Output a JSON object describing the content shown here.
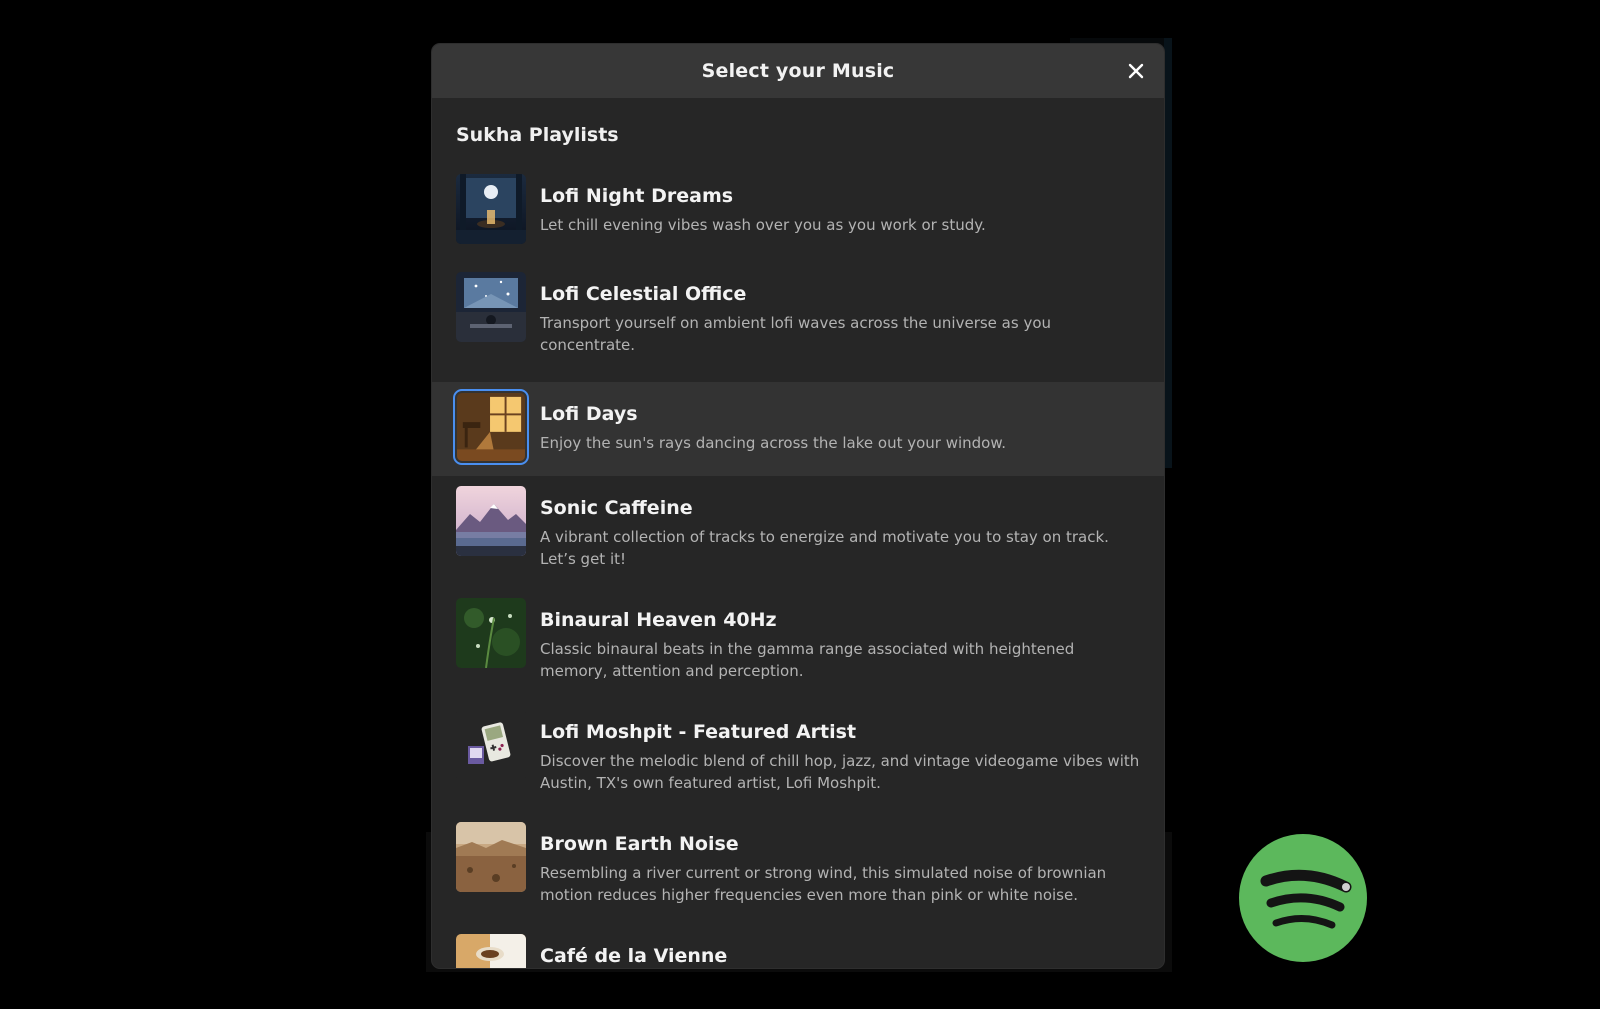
{
  "modal": {
    "title": "Select your Music",
    "section_title": "Sukha Playlists"
  },
  "playlists": [
    {
      "title": "Lofi Night Dreams",
      "description": "Let chill evening vibes wash over you as you work or study.",
      "selected": false
    },
    {
      "title": "Lofi Celestial Office",
      "description": "Transport yourself on ambient lofi waves across the universe as you concentrate.",
      "selected": false
    },
    {
      "title": "Lofi Days",
      "description": "Enjoy the sun's rays dancing across the lake out your window.",
      "selected": true
    },
    {
      "title": "Sonic Caffeine",
      "description": "A vibrant collection of tracks to energize and motivate you to stay on track. Let’s get it!",
      "selected": false
    },
    {
      "title": "Binaural Heaven 40Hz",
      "description": "Classic binaural beats in the gamma range associated with heightened memory, attention and perception.",
      "selected": false
    },
    {
      "title": "Lofi Moshpit - Featured Artist",
      "description": "Discover the melodic blend of chill hop, jazz, and vintage videogame vibes with Austin, TX's own featured artist, Lofi Moshpit.",
      "selected": false
    },
    {
      "title": "Brown Earth Noise",
      "description": "Resembling a river current or strong wind, this simulated noise of brownian motion reduces higher frequencies even more than pink or white noise.",
      "selected": false
    },
    {
      "title": "Café de la Vienne",
      "description": "",
      "selected": false
    }
  ],
  "colors": {
    "selection_border": "#4a8ff0",
    "spotify_green": "#5cb85c",
    "modal_bg": "#262626",
    "header_bg": "#373737"
  },
  "icons": {
    "close": "close-icon",
    "spotify": "spotify-logo-icon"
  }
}
